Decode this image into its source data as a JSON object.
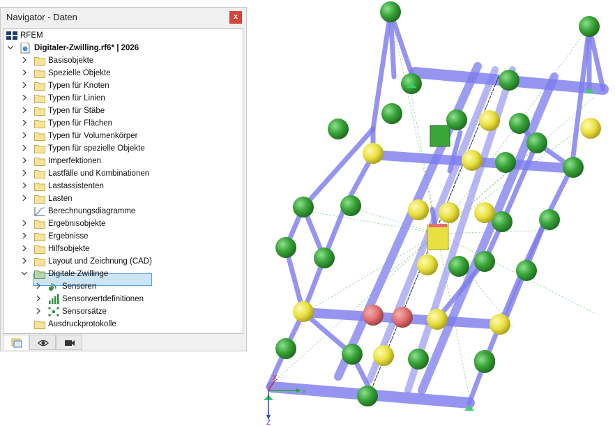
{
  "panel": {
    "title": "Navigator - Daten",
    "close_label": "x"
  },
  "tree": {
    "root": "RFEM",
    "model": "Digitaler-Zwilling.rf6* | 2026",
    "items": [
      {
        "label": "Basisobjekte",
        "icon": "folder-icon"
      },
      {
        "label": "Spezielle Objekte",
        "icon": "folder-icon"
      },
      {
        "label": "Typen für Knoten",
        "icon": "folder-icon"
      },
      {
        "label": "Typen für Linien",
        "icon": "folder-icon"
      },
      {
        "label": "Typen für Stäbe",
        "icon": "folder-icon"
      },
      {
        "label": "Typen für Flächen",
        "icon": "folder-icon"
      },
      {
        "label": "Typen für Volumenkörper",
        "icon": "folder-icon"
      },
      {
        "label": "Typen für spezielle Objekte",
        "icon": "folder-icon"
      },
      {
        "label": "Imperfektionen",
        "icon": "folder-icon"
      },
      {
        "label": "Lastfälle und Kombinationen",
        "icon": "folder-icon"
      },
      {
        "label": "Lastassistenten",
        "icon": "folder-icon"
      },
      {
        "label": "Lasten",
        "icon": "folder-icon"
      },
      {
        "label": "Berechnungsdiagramme",
        "icon": "diagram-icon"
      },
      {
        "label": "Ergebnisobjekte",
        "icon": "folder-icon"
      },
      {
        "label": "Ergebnisse",
        "icon": "folder-icon"
      },
      {
        "label": "Hilfsobjekte",
        "icon": "folder-icon"
      },
      {
        "label": "Layout und Zeichnung (CAD)",
        "icon": "folder-icon"
      },
      {
        "label": "Digitale Zwillinge",
        "icon": "folder-green-icon"
      }
    ],
    "children": [
      {
        "label": "Sensoren",
        "icon": "sensor-icon"
      },
      {
        "label": "Sensorwertdefinitionen",
        "icon": "signal-bars-icon"
      },
      {
        "label": "Sensorsätze",
        "icon": "sensor-set-icon"
      }
    ],
    "last": {
      "label": "Ausdruckprotokolle",
      "icon": "folder-icon"
    }
  },
  "tabs": [
    {
      "name": "data-tab",
      "icon": "data-navigator-icon",
      "active": true
    },
    {
      "name": "view-tab",
      "icon": "eye-icon",
      "active": false
    },
    {
      "name": "camera-tab",
      "icon": "camera-icon",
      "active": false
    }
  ],
  "viewport": {
    "axis_x": "X",
    "axis_y": "Y",
    "axis_z": "Z"
  },
  "colors": {
    "member": "#7b7bee",
    "sensor_green": "#3aa53a",
    "sensor_yellow": "#e8e040",
    "sensor_red": "#e07070",
    "selection": "#cce4f7",
    "close_red": "#d4453a"
  }
}
